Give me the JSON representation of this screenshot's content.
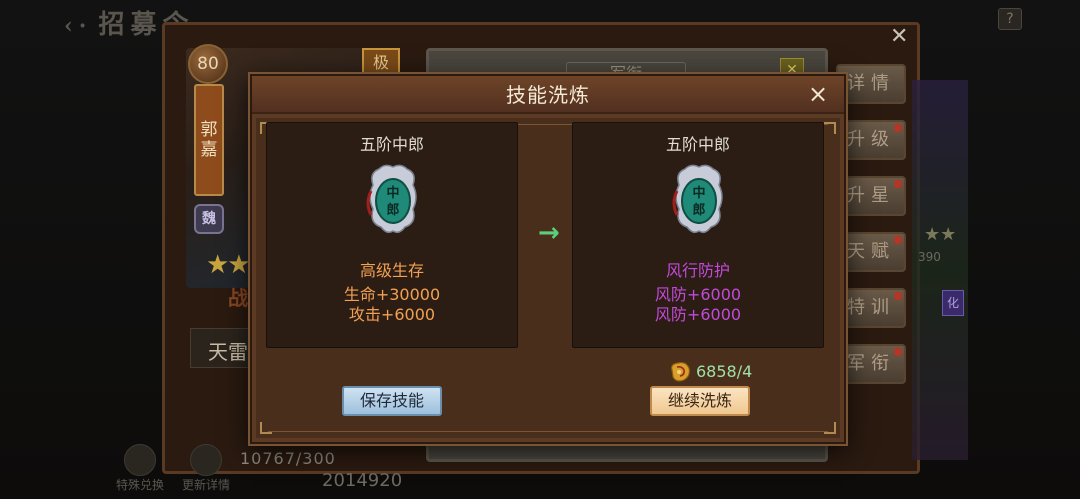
{
  "background": {
    "top_title": "招募令",
    "help_label": "?",
    "hero": {
      "level": "80",
      "name": "郭嘉",
      "faction": "魏",
      "corner_tag": "极",
      "stars": "★★",
      "fight_label": "战",
      "skill_slot_name": "天雷",
      "exp": "10767/300",
      "power": "2014920"
    },
    "right_panel_header": "军衔",
    "side_buttons": [
      {
        "label": "详情",
        "dot": false
      },
      {
        "label": "升级",
        "dot": true
      },
      {
        "label": "升星",
        "dot": true
      },
      {
        "label": "天赋",
        "dot": true
      },
      {
        "label": "特训",
        "dot": true
      },
      {
        "label": "军衔",
        "dot": true
      }
    ],
    "bottom_tabs": [
      "特殊兑换",
      "更新详情"
    ],
    "deco_num": "390",
    "deco_badge": "化"
  },
  "modal": {
    "title": "技能洗炼",
    "close_label": "×",
    "current": {
      "card_name": "五阶中郎",
      "emblem_text": "中郎",
      "skill_name": "高级生存",
      "skill_color": "#f2a052",
      "stats": [
        "生命+30000",
        "攻击+6000"
      ]
    },
    "new": {
      "card_name": "五阶中郎",
      "emblem_text": "中郎",
      "skill_name": "风行防护",
      "skill_color": "#c24ad8",
      "stats": [
        "风防+6000",
        "风防+6000"
      ]
    },
    "arrow": "→",
    "cost": {
      "icon": "gold-token-icon",
      "amount": "6858/4"
    },
    "save_button": "保存技能",
    "continue_button": "继续洗炼"
  }
}
